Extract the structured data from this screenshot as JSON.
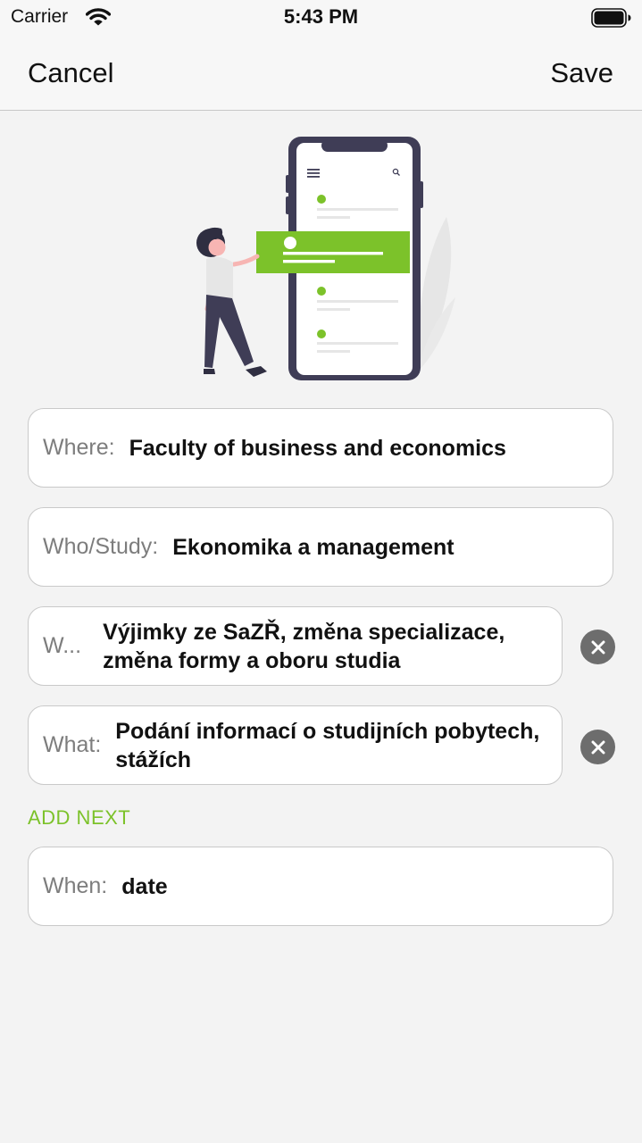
{
  "status_bar": {
    "carrier": "Carrier",
    "time": "5:43 PM"
  },
  "nav": {
    "cancel_label": "Cancel",
    "save_label": "Save"
  },
  "fields": {
    "where": {
      "label": "Where:",
      "value": "Faculty of business and economics"
    },
    "who_study": {
      "label": "Who/Study:",
      "value": "Ekonomika a management"
    },
    "what_1": {
      "label": "W...",
      "value": "Výjimky ze SaZŘ, změna specializace, změna formy a oboru studia"
    },
    "what_2": {
      "label": "What:",
      "value": "Podání informací o studijních pobytech, stážích"
    },
    "when": {
      "label": "When:",
      "value": "date"
    }
  },
  "add_next_label": "ADD NEXT",
  "colors": {
    "accent": "#7cc22a",
    "phone_frame": "#3f3d56",
    "clear_button": "#6d6d6d"
  },
  "icons": [
    "wifi-icon",
    "battery-icon",
    "clear-icon",
    "phone-illustration"
  ]
}
